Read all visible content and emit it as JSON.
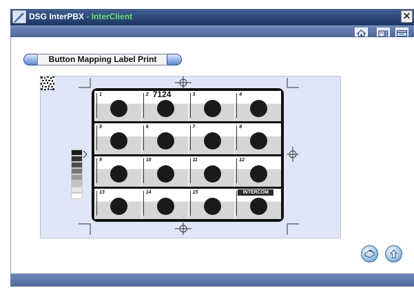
{
  "window": {
    "title_main": "DSG InterPBX",
    "title_sep": " - ",
    "title_sub": "InterClient",
    "close_glyph": "✕"
  },
  "toolbar": {
    "buttons": [
      "home-icon",
      "calendar-icon",
      "window-icon"
    ]
  },
  "section": {
    "title": "Button Mapping Label Print"
  },
  "label": {
    "cells": [
      {
        "num": "1",
        "ext": ""
      },
      {
        "num": "2",
        "ext": "7124"
      },
      {
        "num": "3",
        "ext": ""
      },
      {
        "num": "4",
        "ext": ""
      },
      {
        "num": "5",
        "ext": ""
      },
      {
        "num": "6",
        "ext": ""
      },
      {
        "num": "7",
        "ext": ""
      },
      {
        "num": "8",
        "ext": ""
      },
      {
        "num": "9",
        "ext": ""
      },
      {
        "num": "10",
        "ext": ""
      },
      {
        "num": "11",
        "ext": ""
      },
      {
        "num": "12",
        "ext": ""
      },
      {
        "num": "13",
        "ext": ""
      },
      {
        "num": "14",
        "ext": ""
      },
      {
        "num": "15",
        "ext": ""
      },
      {
        "num": "",
        "ext": "",
        "tag": "INTERCOM"
      }
    ],
    "gray_scale": [
      "#1a1a1a",
      "#333333",
      "#4d4d4d",
      "#777777",
      "#999999",
      "#c4c4c4",
      "#e6e6e6",
      "#ffffff"
    ]
  },
  "actions": {
    "print_icon": "print-icon",
    "up_icon": "up-arrow-icon"
  },
  "colors": {
    "titlebar": "#1c3563",
    "accent_green": "#66e266",
    "preview_bg": "#dfe6f8"
  }
}
